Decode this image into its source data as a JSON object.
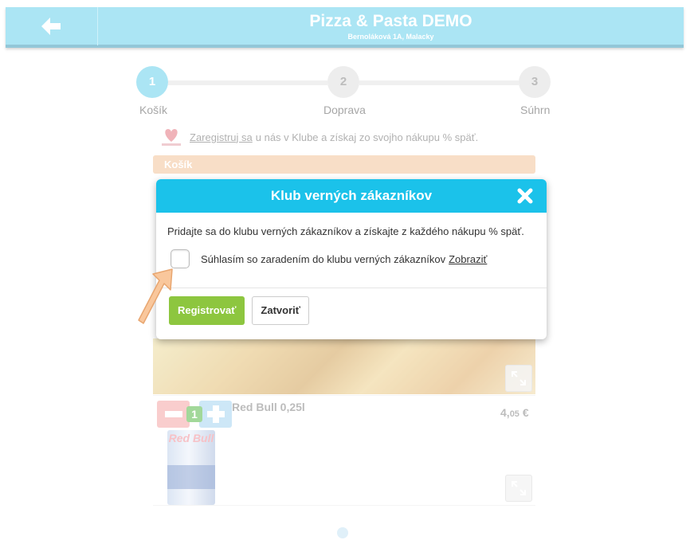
{
  "header": {
    "title": "Pizza & Pasta DEMO",
    "address": "Bernoláková 1A, Malacky",
    "back_icon": "arrow-left-icon"
  },
  "stepper": {
    "steps": [
      {
        "number": "1",
        "label": "Košík",
        "active": true
      },
      {
        "number": "2",
        "label": "Doprava",
        "active": false
      },
      {
        "number": "3",
        "label": "Súhrn",
        "active": false
      }
    ]
  },
  "club_banner": {
    "link_text": "Zaregistruj sa",
    "text": "u nás v Klube a získaj zo svojho nákupu % späť."
  },
  "cart": {
    "section_label": "Košík",
    "item": {
      "name": "Red Bull 0,25l",
      "quantity": "1",
      "price_whole": "4,",
      "price_cents": "05",
      "currency": "€",
      "brand_text": "Red Bull"
    }
  },
  "modal": {
    "title": "Klub verných zákazníkov",
    "description": "Pridajte sa do klubu verných zákazníkov a získajte z každého nákupu % späť.",
    "consent_label": "Súhlasím so zaradením do klubu verných zákazníkov",
    "show_link": "Zobraziť",
    "consent_checked": false,
    "register_button": "Registrovať",
    "close_button": "Zatvoriť"
  },
  "colors": {
    "header_bg": "#7fd8ee",
    "modal_header_bg": "#1bc2ea",
    "register_bg": "#8dc63f",
    "step_active": "#7fd8ee",
    "step_inactive": "#e3e3e3",
    "cart_bar": "#f4ccaa",
    "arrow_fill": "#f9c79c"
  }
}
